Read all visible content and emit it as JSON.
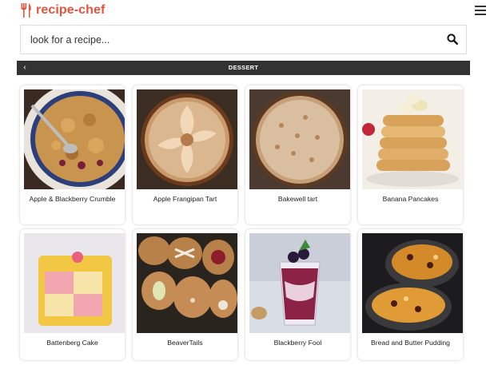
{
  "header": {
    "brand": "recipe-chef",
    "brand_color": "#e5533c",
    "logo_icon": "fork-knife-icon",
    "menu_icon": "hamburger-menu-icon"
  },
  "search": {
    "placeholder": "look for a recipe...",
    "value": "",
    "icon": "search-icon"
  },
  "category": {
    "title": "DESSERT",
    "back_icon": "chevron-left-icon"
  },
  "recipes": [
    {
      "name": "Apple & Blackberry Crumble"
    },
    {
      "name": "Apple Frangipan Tart"
    },
    {
      "name": "Bakewell tart"
    },
    {
      "name": "Banana Pancakes"
    },
    {
      "name": "Battenberg Cake"
    },
    {
      "name": "BeaverTails"
    },
    {
      "name": "Blackberry Fool"
    },
    {
      "name": "Bread and Butter Pudding"
    }
  ]
}
